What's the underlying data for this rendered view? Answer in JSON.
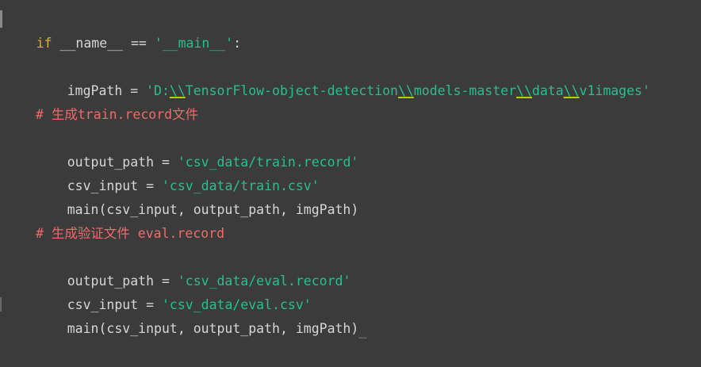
{
  "editor": {
    "line1": {
      "kw": "if",
      "name": " __name__ == ",
      "main_str": "'__main__'",
      "colon": ":"
    },
    "line2": {
      "var": "imgPath = ",
      "q1": "'",
      "drive": "D:",
      "esc": "\\\\",
      "seg1": "TensorFlow-object-detection",
      "seg2": "models-master",
      "seg3": "data",
      "seg4": "v1images",
      "q2": "'"
    },
    "comment1": "# 生成train.record文件",
    "line4": {
      "var": "output_path = ",
      "str": "'csv_data/train.record'"
    },
    "line5": {
      "var": "csv_input = ",
      "str": "'csv_data/train.csv'"
    },
    "line6": {
      "call": "main(csv_input, output_path, imgPath)"
    },
    "comment2": "# 生成验证文件 eval.record",
    "line8": {
      "var": "output_path = ",
      "str": "'csv_data/eval.record'"
    },
    "line9": {
      "var": "csv_input = ",
      "str": "'csv_data/eval.csv'"
    },
    "line10": {
      "call": "main(csv_input, output_path, imgPath)",
      "squiggle": "﹏"
    }
  },
  "colors": {
    "background": "#3b3b3b",
    "keyword": "#e0b030",
    "string": "#25c090",
    "comment": "#f06a6a",
    "text": "#d6d6d6"
  }
}
